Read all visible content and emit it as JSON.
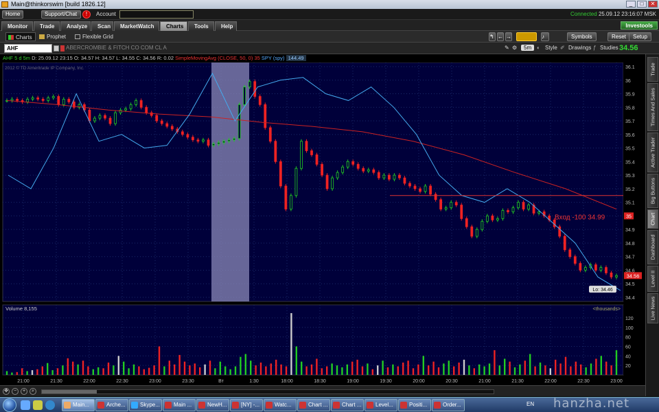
{
  "window": {
    "title": "Main@thinkorswim [build 1826.12]",
    "min": "_",
    "max": "□",
    "close": "✕"
  },
  "topbar": {
    "home": "Home",
    "support": "Support/Chat",
    "alert": "!",
    "account_label": "Account",
    "connected": "Connected",
    "datetime": "25.09.12 23:16:07 MSK"
  },
  "nav": {
    "tabs": [
      "Monitor",
      "Trade",
      "Analyze",
      "Scan",
      "MarketWatch",
      "Charts",
      "Tools",
      "Help"
    ],
    "active": "Charts",
    "investools": "Investools"
  },
  "subnav": {
    "tabs": [
      "Charts",
      "Prophet",
      "Flexible Grid"
    ],
    "symbols": "Symbols",
    "reset": "Reset",
    "setup": "Setup"
  },
  "chartbar": {
    "symbol": "AHF",
    "company": "ABERCROMBIE & FITCH CO COM CL A",
    "timeframe": "5m",
    "style": "Style",
    "drawings": "Drawings",
    "studies": "Studies",
    "last": "34.56"
  },
  "info": {
    "symbol_tf": "AHF 5 d 5m",
    "d": "D: 25.09.12 23:15",
    "o": "O: 34.57",
    "h": "H: 34.57",
    "l": "L: 34.55",
    "c": "C: 34.56",
    "r": "R: 0.02",
    "sma": "SimpleMovingAvg (CLOSE, 50, 0)",
    "sma_val": "35",
    "spy": "SPY (spy)",
    "spy_val": "144.49"
  },
  "colors": {
    "bg": "#00003a",
    "up": "#22cc22",
    "down": "#ee2222",
    "sma": "#cc2222",
    "spy": "#44aaee",
    "highlight": "#8a88b8"
  },
  "chart_data": {
    "type": "candlestick",
    "copyright": "2012 © TD Ameritrade IP Company, Inc.",
    "price_ticks": [
      "36.1",
      "36",
      "35.9",
      "35.8",
      "35.7",
      "35.6",
      "35.5",
      "35.4",
      "35.3",
      "35.2",
      "35.1",
      "35",
      "34.9",
      "34.8",
      "34.7",
      "34.6",
      "34.5",
      "34.4"
    ],
    "ylim": [
      34.4,
      36.1
    ],
    "x_ticks": [
      "21:00",
      "21:30",
      "22:00",
      "22:30",
      "23:00",
      "23:30",
      "Вт",
      "1:30",
      "18:00",
      "18:30",
      "19:00",
      "19:30",
      "20:00",
      "20:30",
      "21:00",
      "21:30",
      "22:00",
      "22:30",
      "23:00"
    ],
    "close": [
      35.85,
      35.86,
      35.85,
      35.84,
      35.86,
      35.87,
      35.86,
      35.85,
      35.87,
      35.88,
      35.82,
      35.86,
      35.84,
      35.8,
      35.82,
      35.78,
      35.7,
      35.72,
      35.74,
      35.72,
      35.68,
      35.76,
      35.78,
      35.79,
      35.82,
      35.85,
      35.8,
      35.76,
      35.74,
      35.7,
      35.68,
      35.66,
      35.64,
      35.62,
      35.6,
      35.58,
      35.56,
      35.55,
      35.56,
      35.52,
      35.53,
      35.54,
      35.55,
      35.56,
      35.57,
      35.82,
      35.95,
      35.99,
      35.88,
      35.82,
      35.65,
      35.55,
      35.4,
      35.22,
      35.05,
      35.15,
      35.35,
      35.55,
      35.48,
      35.45,
      35.38,
      35.3,
      35.2,
      35.28,
      35.32,
      35.36,
      35.4,
      35.38,
      35.35,
      35.33,
      35.34,
      35.32,
      35.28,
      35.3,
      35.27,
      35.3,
      35.28,
      35.24,
      35.22,
      35.2,
      35.18,
      35.22,
      35.16,
      35.12,
      35.05,
      35.06,
      35.1,
      35.08,
      34.98,
      34.92,
      34.85,
      34.9,
      34.96,
      35.0,
      34.97,
      34.98,
      35.04,
      35.03,
      35.06,
      35.1,
      35.05,
      35.08,
      35.02,
      35.03,
      35.0,
      34.97,
      34.92,
      34.85,
      34.75,
      34.7,
      34.65,
      34.6,
      34.62,
      34.64,
      34.6,
      34.62,
      34.58,
      34.55,
      34.56
    ],
    "sma": [
      35.85,
      35.82,
      35.78,
      35.75,
      35.73,
      35.69,
      35.66,
      35.62,
      35.55,
      35.45,
      35.32,
      35.2,
      35.05
    ],
    "spy": [
      35.3,
      35.2,
      35.5,
      35.9,
      35.55,
      35.6,
      35.5,
      35.52,
      35.75,
      36.05,
      35.7,
      35.95,
      36.0,
      36.02,
      35.9,
      35.85,
      35.95,
      35.8,
      35.6,
      35.3,
      35.15,
      35.1,
      35.2,
      35.1,
      34.95,
      34.8,
      34.55,
      34.45
    ],
    "entry": {
      "label": "Вход -100",
      "price": 34.99,
      "line": 35.15,
      "marker": "35"
    },
    "price_tag": "34.56",
    "low_label": "Lo: 34.46",
    "volume": {
      "label": "Volume",
      "value": "8,155",
      "units": "<thousands>",
      "ticks": [
        "120",
        "100",
        "80",
        "60",
        "40",
        "20"
      ],
      "ylim": [
        0,
        130
      ],
      "values": [
        8,
        5,
        6,
        14,
        8,
        10,
        12,
        18,
        25,
        10,
        14,
        20,
        35,
        28,
        22,
        30,
        18,
        12,
        16,
        14,
        26,
        20,
        40,
        28,
        14,
        22,
        18,
        12,
        15,
        20,
        60,
        18,
        30,
        22,
        42,
        28,
        20,
        24,
        16,
        22,
        30,
        14,
        28,
        18,
        12,
        18,
        38,
        44,
        30,
        20,
        26,
        18,
        24,
        32,
        22,
        18,
        130,
        60,
        28,
        18,
        22,
        34,
        14,
        18,
        24,
        20,
        16,
        22,
        28,
        32,
        18,
        24,
        12,
        20,
        30,
        16,
        22,
        18,
        26,
        30,
        14,
        22,
        40,
        20,
        28,
        16,
        24,
        30,
        18,
        26,
        32,
        20,
        14,
        22,
        18,
        24,
        52,
        20,
        34,
        28,
        16,
        22,
        30,
        44,
        18,
        26,
        20,
        14,
        32,
        24,
        38,
        18,
        28,
        22,
        16,
        24,
        34,
        40,
        28,
        20,
        52
      ]
    }
  },
  "side_tabs": [
    "Trade",
    "Times And Sales",
    "Active Trader",
    "Big Buttons",
    "Chart",
    "Dashboard",
    "Level II",
    "Live News"
  ],
  "taskbar": {
    "items": [
      "Main...",
      "Arche...",
      "Skype...",
      "Main ...",
      "NewH...",
      "[NY] -...",
      "Watc...",
      "Chart ...",
      "Chart ...",
      "Level...",
      "Positi...",
      "Order..."
    ],
    "lang": "EN"
  },
  "watermark": "hanzha.net"
}
